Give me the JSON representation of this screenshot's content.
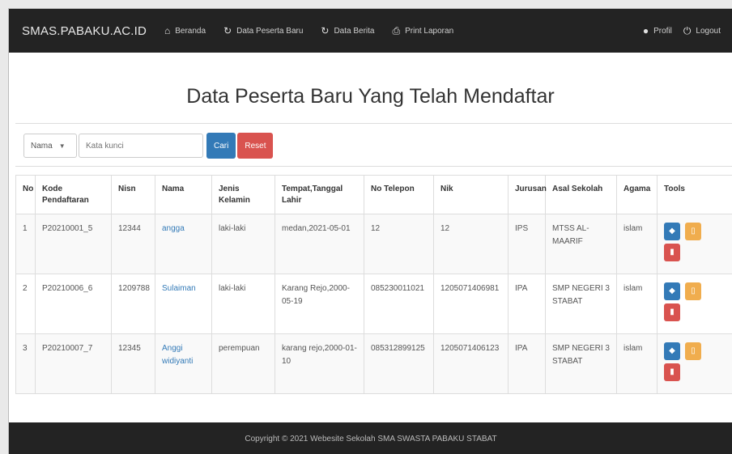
{
  "brand": "SMAS.PABAKU.AC.ID",
  "nav": {
    "items": [
      {
        "icon": "home-icon",
        "glyph": "⌂",
        "label": "Beranda"
      },
      {
        "icon": "refresh-icon",
        "glyph": "↻",
        "label": "Data Peserta Baru"
      },
      {
        "icon": "refresh-icon",
        "glyph": "↻",
        "label": "Data Berita"
      },
      {
        "icon": "print-icon",
        "glyph": "⎙",
        "label": "Print Laporan"
      }
    ],
    "profile": {
      "icon": "user-icon",
      "glyph": "●",
      "label": "Profil"
    },
    "logout": {
      "icon": "logout-icon",
      "glyph": "⏻",
      "label": "Logout"
    }
  },
  "page": {
    "title": "Data Peserta Baru Yang Telah Mendaftar"
  },
  "search": {
    "select_value": "Nama",
    "placeholder": "Kata kunci",
    "cari_label": "Cari",
    "reset_label": "Reset"
  },
  "table": {
    "headers": [
      "No",
      "Kode Pendaftaran",
      "Nisn",
      "Nama",
      "Jenis Kelamin",
      "Tempat,Tanggal Lahir",
      "No Telepon",
      "Nik",
      "Jurusan",
      "Asal Sekolah",
      "Agama",
      "Tools"
    ],
    "rows": [
      [
        "1",
        "P20210001_5",
        "12344",
        "angga",
        "laki-laki",
        "medan,2021-05-01",
        "12",
        "12",
        "IPS",
        "MTSS AL-MAARIF",
        "islam"
      ],
      [
        "2",
        "P20210006_6",
        "1209788",
        "Sulaiman",
        "laki-laki",
        "Karang Rejo,2000-05-19",
        "085230011021",
        "1205071406981",
        "IPA",
        "SMP NEGERI 3 STABAT",
        "islam"
      ],
      [
        "3",
        "P20210007_7",
        "12345",
        "Anggi widiyanti",
        "perempuan",
        "karang rejo,2000-01-10",
        "085312899125",
        "1205071406123",
        "IPA",
        "SMP NEGERI 3 STABAT",
        "islam"
      ]
    ]
  },
  "footer": {
    "text": "Copyright © 2021 Webesite Sekolah SMA SWASTA PABAKU STABAT"
  },
  "colors": {
    "navbar": "#232323",
    "primary": "#337ab7",
    "danger": "#d9534f",
    "warning": "#f0ad4e"
  }
}
